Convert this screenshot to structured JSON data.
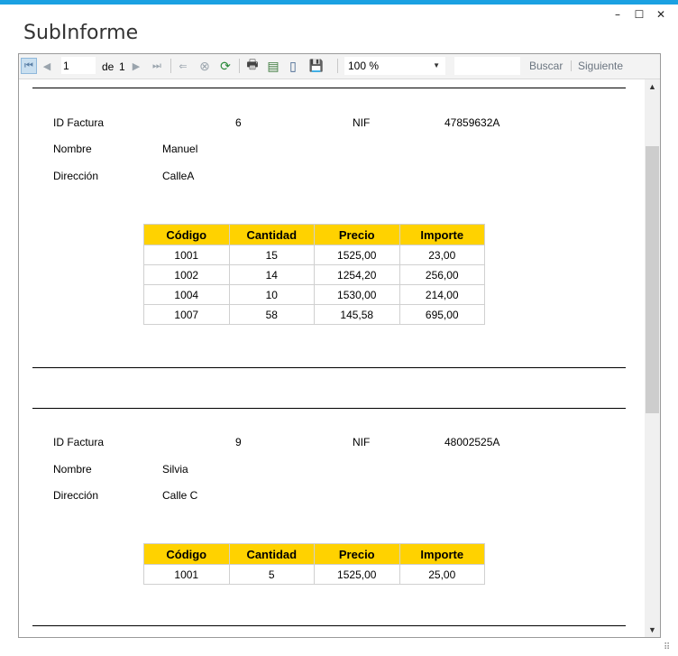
{
  "window": {
    "title": "SubInforme",
    "controls": {
      "minimize": "–",
      "maximize": "☐",
      "close": "✕"
    }
  },
  "toolbar": {
    "page_value": "1",
    "of_label": "de",
    "total_pages": "1",
    "zoom_value": "100 %",
    "find_value": "",
    "find_label": "Buscar",
    "next_label": "Siguiente",
    "icons": {
      "first": "⏮",
      "prev": "◀",
      "next": "▶",
      "last": "⏭",
      "back": "⇐",
      "stop": "⊗",
      "refresh": "⟳",
      "print": "🖶",
      "layout": "▤",
      "page_setup": "▯",
      "export": "💾"
    }
  },
  "report": {
    "field_labels": {
      "id": "ID Factura",
      "nif": "NIF",
      "name": "Nombre",
      "address": "Dirección"
    },
    "columns": [
      "Código",
      "Cantidad",
      "Precio",
      "Importe"
    ],
    "invoices": [
      {
        "id": "6",
        "nif": "47859632A",
        "name": "Manuel",
        "address": "CalleA",
        "rows": [
          [
            "1001",
            "15",
            "1525,00",
            "23,00"
          ],
          [
            "1002",
            "14",
            "1254,20",
            "256,00"
          ],
          [
            "1004",
            "10",
            "1530,00",
            "214,00"
          ],
          [
            "1007",
            "58",
            "145,58",
            "695,00"
          ]
        ]
      },
      {
        "id": "9",
        "nif": "48002525A",
        "name": "Silvia",
        "address": "Calle C",
        "rows": [
          [
            "1001",
            "5",
            "1525,00",
            "25,00"
          ]
        ]
      }
    ]
  },
  "scrollbar": {
    "up": "▲",
    "down": "▼",
    "position": 0.12
  },
  "resize_grip": "⠿",
  "colors": {
    "accent": "#1ba1e2",
    "header_fill": "#ffd200"
  }
}
